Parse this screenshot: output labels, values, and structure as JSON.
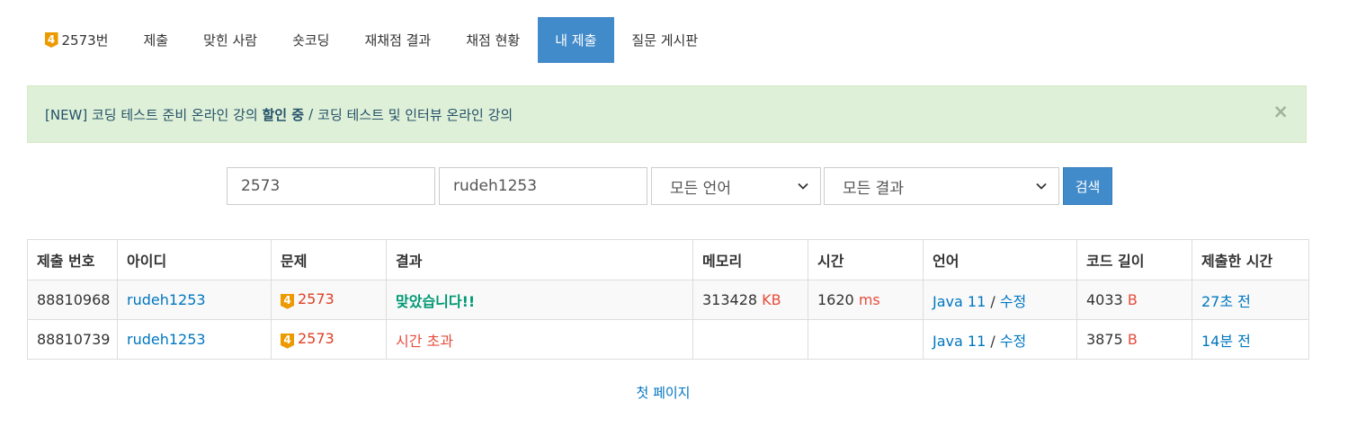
{
  "tabs": [
    {
      "label": "2573번",
      "tier": "4",
      "active": false
    },
    {
      "label": "제출",
      "active": false
    },
    {
      "label": "맞힌 사람",
      "active": false
    },
    {
      "label": "숏코딩",
      "active": false
    },
    {
      "label": "재채점 결과",
      "active": false
    },
    {
      "label": "채점 현황",
      "active": false
    },
    {
      "label": "내 제출",
      "active": true
    },
    {
      "label": "질문 게시판",
      "active": false
    }
  ],
  "alert": {
    "prefix": "[NEW] 코딩 테스트 준비 온라인 강의",
    "highlight": "할인 중",
    "separator": "/",
    "link2": "코딩 테스트 및 인터뷰 온라인 강의",
    "close": "×"
  },
  "filter": {
    "problem_id": "2573",
    "user_id": "rudeh1253",
    "language": "모든 언어",
    "result": "모든 결과",
    "search_label": "검색"
  },
  "table": {
    "headers": [
      "제출 번호",
      "아이디",
      "문제",
      "결과",
      "메모리",
      "시간",
      "언어",
      "코드 길이",
      "제출한 시간"
    ],
    "rows": [
      {
        "submission_id": "88810968",
        "user": "rudeh1253",
        "tier": "4",
        "problem": "2573",
        "result": "맞았습니다!!",
        "memory": "313428",
        "memory_unit": "KB",
        "time": "1620",
        "time_unit": "ms",
        "language": "Java 11",
        "lang_sep": "/",
        "edit": "수정",
        "code_length": "4033",
        "code_unit": "B",
        "submitted": "27초 전"
      },
      {
        "submission_id": "88810739",
        "user": "rudeh1253",
        "tier": "4",
        "problem": "2573",
        "result": "시간 초과",
        "memory": "",
        "memory_unit": "",
        "time": "",
        "time_unit": "",
        "language": "Java 11",
        "lang_sep": "/",
        "edit": "수정",
        "code_length": "3875",
        "code_unit": "B",
        "submitted": "14분 전"
      }
    ]
  },
  "pagination": {
    "first_page": "첫 페이지"
  },
  "colors": {
    "primary": "#428bca",
    "link": "#0076c0",
    "accepted": "#009874",
    "error": "#e74c3c",
    "tier_gold": "#ec9a00"
  }
}
